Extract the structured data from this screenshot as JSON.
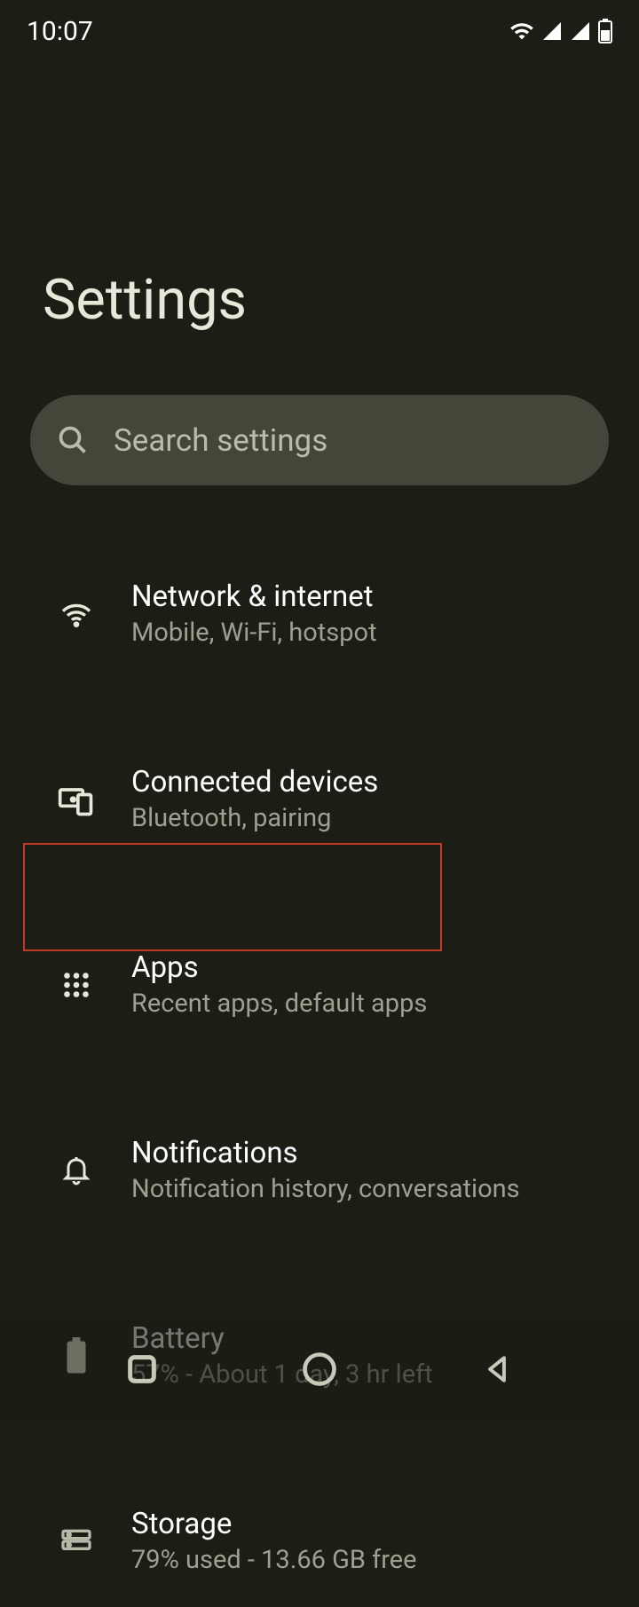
{
  "status": {
    "time": "10:07"
  },
  "page": {
    "title": "Settings"
  },
  "search": {
    "placeholder": "Search settings"
  },
  "items": [
    {
      "title": "Network & internet",
      "subtitle": "Mobile, Wi-Fi, hotspot"
    },
    {
      "title": "Connected devices",
      "subtitle": "Bluetooth, pairing"
    },
    {
      "title": "Apps",
      "subtitle": "Recent apps, default apps"
    },
    {
      "title": "Notifications",
      "subtitle": "Notification history, conversations"
    },
    {
      "title": "Battery",
      "subtitle": "57% - About 1 day, 3 hr left"
    },
    {
      "title": "Storage",
      "subtitle": "79% used - 13.66 GB free"
    }
  ]
}
